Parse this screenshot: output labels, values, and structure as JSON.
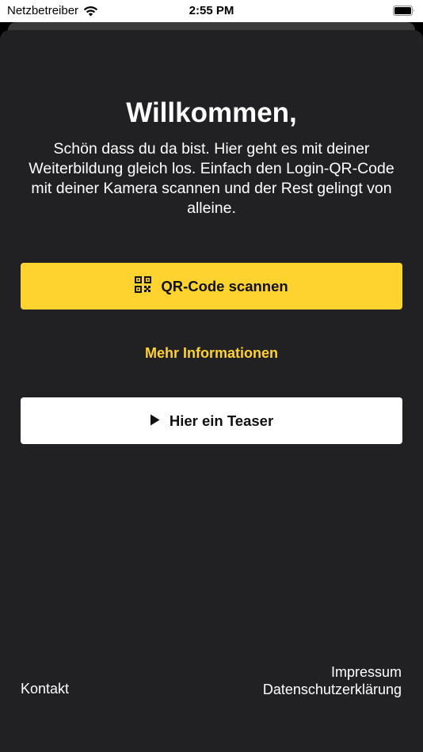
{
  "status_bar": {
    "carrier": "Netzbetreiber",
    "time": "2:55 PM",
    "wifi_icon": "wifi-icon",
    "battery_icon": "battery-icon"
  },
  "welcome": {
    "title": "Willkommen,",
    "text": "Schön dass du da bist. Hier geht es mit deiner Weiterbildung gleich los. Einfach den Login-QR-Code mit deiner Kamera scannen und der Rest gelingt von alleine."
  },
  "actions": {
    "scan_label": "QR-Code scannen",
    "scan_icon": "qr-code-icon",
    "more_info_label": "Mehr Informationen",
    "teaser_label": "Hier ein Teaser",
    "teaser_icon": "play-icon"
  },
  "footer": {
    "contact": "Kontakt",
    "imprint": "Impressum",
    "privacy": "Datenschutzerklärung"
  },
  "colors": {
    "background": "#212123",
    "accent": "#fed330",
    "text": "#ffffff"
  }
}
